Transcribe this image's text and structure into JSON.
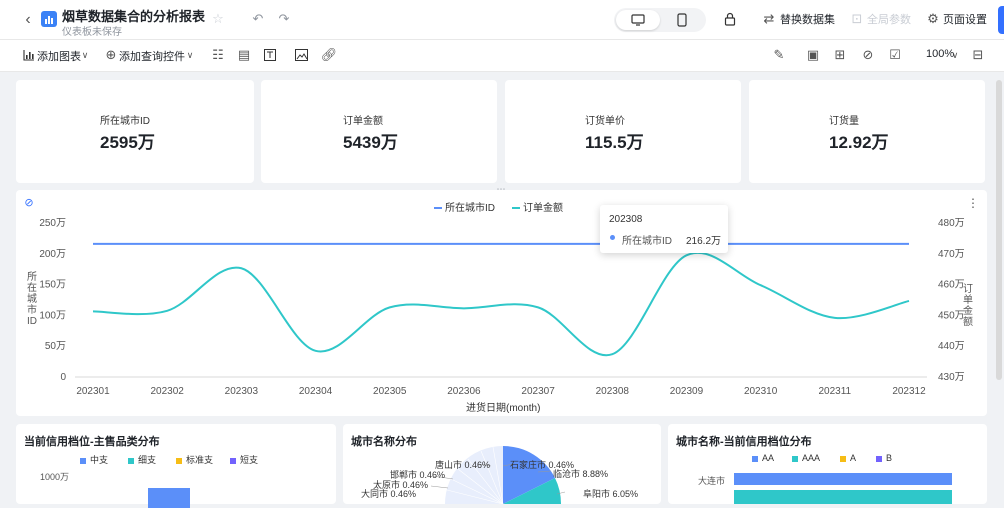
{
  "header": {
    "title": "烟草数据集合的分析报表",
    "subtitle": "仪表板未保存",
    "replace_dataset": "替换数据集",
    "global_params": "全局参数",
    "page_settings": "页面设置"
  },
  "toolbar": {
    "add_chart": "添加图表",
    "add_query_control": "添加查询控件",
    "zoom": "100%"
  },
  "kpis": [
    {
      "label": "所在城市ID",
      "value": "2595万"
    },
    {
      "label": "订单金额",
      "value": "5439万"
    },
    {
      "label": "订货单价",
      "value": "115.5万"
    },
    {
      "label": "订货量",
      "value": "12.92万"
    }
  ],
  "line_chart": {
    "legend": [
      "所在城市ID",
      "订单金额"
    ],
    "colors": {
      "city_id": "#5b8ff9",
      "amount": "#2fc7c9"
    },
    "xlabel": "进货日期(month)",
    "ylabel_left": "所在城市ID",
    "ylabel_right": "订单金额",
    "left_ticks": [
      "250万",
      "200万",
      "150万",
      "100万",
      "50万",
      "0"
    ],
    "right_ticks": [
      "480万",
      "470万",
      "460万",
      "450万",
      "440万",
      "430万"
    ],
    "tooltip": {
      "period": "202308",
      "series": "所在城市ID",
      "value": "216.2万"
    }
  },
  "chart_data": {
    "type": "line",
    "x": [
      "202301",
      "202302",
      "202303",
      "202304",
      "202305",
      "202306",
      "202307",
      "202308",
      "202309",
      "202310",
      "202311",
      "202312"
    ],
    "series": [
      {
        "name": "所在城市ID",
        "axis": "left",
        "values": [
          216.2,
          216.2,
          216.2,
          216.2,
          216.2,
          216.2,
          216.2,
          216.2,
          216.2,
          216.2,
          216.2,
          216.2
        ]
      },
      {
        "name": "订单金额",
        "axis": "right",
        "values": [
          451.3,
          451.5,
          465.3,
          438.5,
          452.6,
          452.3,
          452.6,
          437.4,
          469.5,
          459.8,
          449.2,
          454.7
        ]
      }
    ],
    "xlabel": "进货日期(month)",
    "ylabel": "所在城市ID",
    "y2label": "订单金额",
    "ylim": [
      0,
      250
    ],
    "y2lim": [
      430,
      480
    ],
    "legend": "top-center",
    "grid": false
  },
  "bottom": {
    "panel1": {
      "title": "当前信用档位-主售品类分布",
      "legend": [
        "中支",
        "细支",
        "标准支",
        "短支"
      ],
      "legend_colors": [
        "#5b8ff9",
        "#2fc7c9",
        "#f6bd16",
        "#7262fd"
      ],
      "tick": "1000万"
    },
    "panel2": {
      "title": "城市名称分布",
      "labels": [
        "唐山市 0.46%",
        "石家庄市 0.46%",
        "邯郸市 0.46%",
        "临沧市 8.88%",
        "太原市 0.46%",
        "大同市 0.46%",
        "阜阳市 6.05%"
      ]
    },
    "panel3": {
      "title": "城市名称-当前信用档位分布",
      "legend": [
        "AA",
        "AAA",
        "A",
        "B"
      ],
      "legend_colors": [
        "#5b8ff9",
        "#2fc7c9",
        "#f6bd16",
        "#7262fd"
      ],
      "row_label": "大连市"
    }
  }
}
